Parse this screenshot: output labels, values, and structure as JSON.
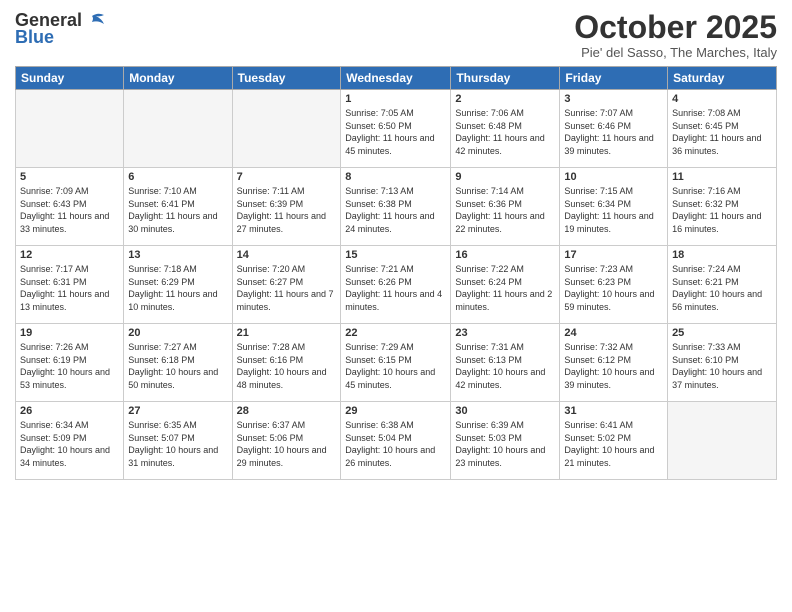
{
  "logo": {
    "general": "General",
    "blue": "Blue"
  },
  "header": {
    "month_title": "October 2025",
    "subtitle": "Pie' del Sasso, The Marches, Italy"
  },
  "weekdays": [
    "Sunday",
    "Monday",
    "Tuesday",
    "Wednesday",
    "Thursday",
    "Friday",
    "Saturday"
  ],
  "weeks": [
    [
      {
        "day": "",
        "info": ""
      },
      {
        "day": "",
        "info": ""
      },
      {
        "day": "",
        "info": ""
      },
      {
        "day": "1",
        "info": "Sunrise: 7:05 AM\nSunset: 6:50 PM\nDaylight: 11 hours and 45 minutes."
      },
      {
        "day": "2",
        "info": "Sunrise: 7:06 AM\nSunset: 6:48 PM\nDaylight: 11 hours and 42 minutes."
      },
      {
        "day": "3",
        "info": "Sunrise: 7:07 AM\nSunset: 6:46 PM\nDaylight: 11 hours and 39 minutes."
      },
      {
        "day": "4",
        "info": "Sunrise: 7:08 AM\nSunset: 6:45 PM\nDaylight: 11 hours and 36 minutes."
      }
    ],
    [
      {
        "day": "5",
        "info": "Sunrise: 7:09 AM\nSunset: 6:43 PM\nDaylight: 11 hours and 33 minutes."
      },
      {
        "day": "6",
        "info": "Sunrise: 7:10 AM\nSunset: 6:41 PM\nDaylight: 11 hours and 30 minutes."
      },
      {
        "day": "7",
        "info": "Sunrise: 7:11 AM\nSunset: 6:39 PM\nDaylight: 11 hours and 27 minutes."
      },
      {
        "day": "8",
        "info": "Sunrise: 7:13 AM\nSunset: 6:38 PM\nDaylight: 11 hours and 24 minutes."
      },
      {
        "day": "9",
        "info": "Sunrise: 7:14 AM\nSunset: 6:36 PM\nDaylight: 11 hours and 22 minutes."
      },
      {
        "day": "10",
        "info": "Sunrise: 7:15 AM\nSunset: 6:34 PM\nDaylight: 11 hours and 19 minutes."
      },
      {
        "day": "11",
        "info": "Sunrise: 7:16 AM\nSunset: 6:32 PM\nDaylight: 11 hours and 16 minutes."
      }
    ],
    [
      {
        "day": "12",
        "info": "Sunrise: 7:17 AM\nSunset: 6:31 PM\nDaylight: 11 hours and 13 minutes."
      },
      {
        "day": "13",
        "info": "Sunrise: 7:18 AM\nSunset: 6:29 PM\nDaylight: 11 hours and 10 minutes."
      },
      {
        "day": "14",
        "info": "Sunrise: 7:20 AM\nSunset: 6:27 PM\nDaylight: 11 hours and 7 minutes."
      },
      {
        "day": "15",
        "info": "Sunrise: 7:21 AM\nSunset: 6:26 PM\nDaylight: 11 hours and 4 minutes."
      },
      {
        "day": "16",
        "info": "Sunrise: 7:22 AM\nSunset: 6:24 PM\nDaylight: 11 hours and 2 minutes."
      },
      {
        "day": "17",
        "info": "Sunrise: 7:23 AM\nSunset: 6:23 PM\nDaylight: 10 hours and 59 minutes."
      },
      {
        "day": "18",
        "info": "Sunrise: 7:24 AM\nSunset: 6:21 PM\nDaylight: 10 hours and 56 minutes."
      }
    ],
    [
      {
        "day": "19",
        "info": "Sunrise: 7:26 AM\nSunset: 6:19 PM\nDaylight: 10 hours and 53 minutes."
      },
      {
        "day": "20",
        "info": "Sunrise: 7:27 AM\nSunset: 6:18 PM\nDaylight: 10 hours and 50 minutes."
      },
      {
        "day": "21",
        "info": "Sunrise: 7:28 AM\nSunset: 6:16 PM\nDaylight: 10 hours and 48 minutes."
      },
      {
        "day": "22",
        "info": "Sunrise: 7:29 AM\nSunset: 6:15 PM\nDaylight: 10 hours and 45 minutes."
      },
      {
        "day": "23",
        "info": "Sunrise: 7:31 AM\nSunset: 6:13 PM\nDaylight: 10 hours and 42 minutes."
      },
      {
        "day": "24",
        "info": "Sunrise: 7:32 AM\nSunset: 6:12 PM\nDaylight: 10 hours and 39 minutes."
      },
      {
        "day": "25",
        "info": "Sunrise: 7:33 AM\nSunset: 6:10 PM\nDaylight: 10 hours and 37 minutes."
      }
    ],
    [
      {
        "day": "26",
        "info": "Sunrise: 6:34 AM\nSunset: 5:09 PM\nDaylight: 10 hours and 34 minutes."
      },
      {
        "day": "27",
        "info": "Sunrise: 6:35 AM\nSunset: 5:07 PM\nDaylight: 10 hours and 31 minutes."
      },
      {
        "day": "28",
        "info": "Sunrise: 6:37 AM\nSunset: 5:06 PM\nDaylight: 10 hours and 29 minutes."
      },
      {
        "day": "29",
        "info": "Sunrise: 6:38 AM\nSunset: 5:04 PM\nDaylight: 10 hours and 26 minutes."
      },
      {
        "day": "30",
        "info": "Sunrise: 6:39 AM\nSunset: 5:03 PM\nDaylight: 10 hours and 23 minutes."
      },
      {
        "day": "31",
        "info": "Sunrise: 6:41 AM\nSunset: 5:02 PM\nDaylight: 10 hours and 21 minutes."
      },
      {
        "day": "",
        "info": ""
      }
    ]
  ]
}
